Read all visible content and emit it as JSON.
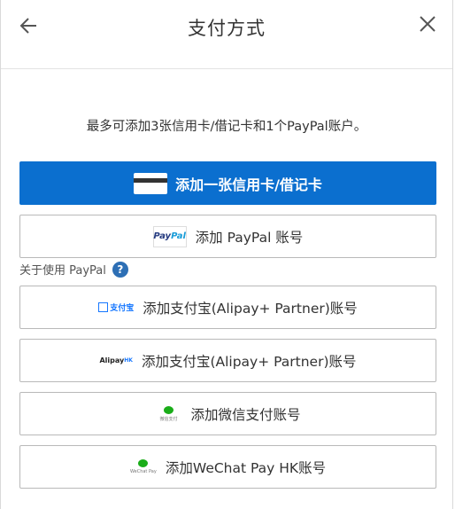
{
  "header": {
    "title": "支付方式",
    "back_icon": "arrow-left-icon",
    "close_icon": "close-icon"
  },
  "notice": "最多可添加3张信用卡/借记卡和1个PayPal账户。",
  "buttons": {
    "add_card": "添加一张信用卡/借记卡",
    "add_paypal": "添加 PayPal 账号",
    "add_alipay": "添加支付宝(Alipay+ Partner)账号",
    "add_alipay_hk": "添加支付宝(Alipay+ Partner)账号",
    "add_wechat": "添加微信支付账号",
    "add_wechat_hk": "添加WeChat Pay HK账号"
  },
  "logos": {
    "paypal_a": "Pay",
    "paypal_b": "Pal",
    "alipay": "支付宝",
    "alipay_hk_main": "Alipay",
    "alipay_hk_sub": "HK",
    "wechat": "微信支付",
    "wechat_hk": "WeChat Pay"
  },
  "about": {
    "label": "关于使用 PayPal",
    "help": "?"
  },
  "colors": {
    "primary": "#0b6fcf",
    "help": "#2d6fb5",
    "wechat": "#1aad19",
    "alipay": "#1677ff"
  }
}
